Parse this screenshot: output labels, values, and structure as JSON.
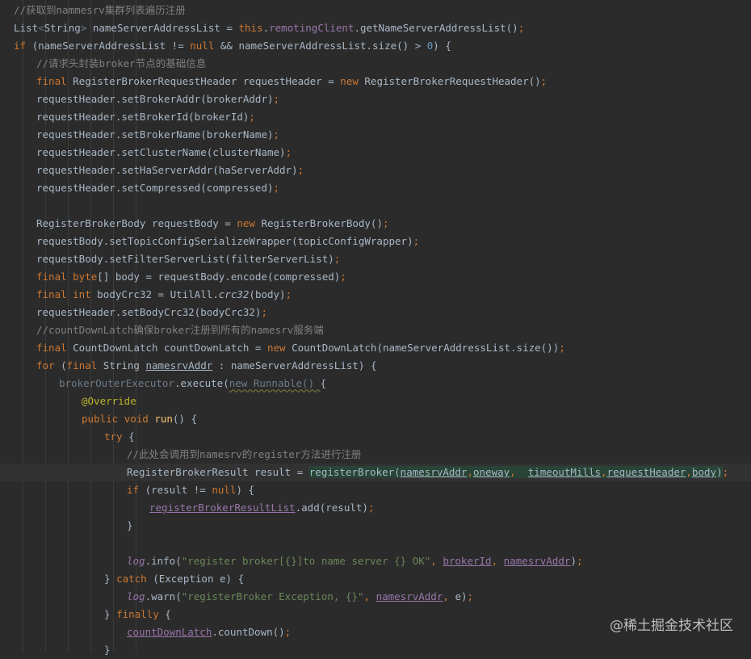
{
  "editor": {
    "lines": [
      {
        "indent": 0,
        "tokens": [
          {
            "t": "//获取到nammesrv集群列表遍历注册",
            "c": "cm"
          }
        ]
      },
      {
        "indent": 0,
        "tokens": [
          {
            "t": "List",
            "c": ""
          },
          {
            "t": "<",
            "c": "dim"
          },
          {
            "t": "String",
            "c": ""
          },
          {
            "t": "> ",
            "c": "dim"
          },
          {
            "t": "nameServerAddressList = ",
            "c": ""
          },
          {
            "t": "this",
            "c": "kw"
          },
          {
            "t": ".",
            "c": ""
          },
          {
            "t": "remotingClient",
            "c": "fld"
          },
          {
            "t": ".getNameServerAddressList()",
            "c": ""
          },
          {
            "t": ";",
            "c": "sc"
          }
        ]
      },
      {
        "indent": 0,
        "tokens": [
          {
            "t": "if ",
            "c": "kw"
          },
          {
            "t": "(nameServerAddressList != ",
            "c": ""
          },
          {
            "t": "null ",
            "c": "kw"
          },
          {
            "t": "&& nameServerAddressList.size() > ",
            "c": ""
          },
          {
            "t": "0",
            "c": "num"
          },
          {
            "t": ") {",
            "c": ""
          }
        ]
      },
      {
        "indent": 1,
        "tokens": [
          {
            "t": "//请求头封装broker节点的基础信息",
            "c": "cm"
          }
        ]
      },
      {
        "indent": 1,
        "tokens": [
          {
            "t": "final ",
            "c": "kw"
          },
          {
            "t": "RegisterBrokerRequestHeader requestHeader = ",
            "c": ""
          },
          {
            "t": "new ",
            "c": "kw"
          },
          {
            "t": "RegisterBrokerRequestHeader()",
            "c": ""
          },
          {
            "t": ";",
            "c": "sc"
          }
        ]
      },
      {
        "indent": 1,
        "tokens": [
          {
            "t": "requestHeader.setBrokerAddr(brokerAddr)",
            "c": ""
          },
          {
            "t": ";",
            "c": "sc"
          }
        ]
      },
      {
        "indent": 1,
        "tokens": [
          {
            "t": "requestHeader.setBrokerId(brokerId)",
            "c": ""
          },
          {
            "t": ";",
            "c": "sc"
          }
        ]
      },
      {
        "indent": 1,
        "tokens": [
          {
            "t": "requestHeader.setBrokerName(brokerName)",
            "c": ""
          },
          {
            "t": ";",
            "c": "sc"
          }
        ]
      },
      {
        "indent": 1,
        "tokens": [
          {
            "t": "requestHeader.setClusterName(clusterName)",
            "c": ""
          },
          {
            "t": ";",
            "c": "sc"
          }
        ]
      },
      {
        "indent": 1,
        "tokens": [
          {
            "t": "requestHeader.setHaServerAddr(haServerAddr)",
            "c": ""
          },
          {
            "t": ";",
            "c": "sc"
          }
        ]
      },
      {
        "indent": 1,
        "tokens": [
          {
            "t": "requestHeader.setCompressed(compressed)",
            "c": ""
          },
          {
            "t": ";",
            "c": "sc"
          }
        ]
      },
      {
        "indent": 1,
        "tokens": []
      },
      {
        "indent": 1,
        "tokens": [
          {
            "t": "RegisterBrokerBody requestBody = ",
            "c": ""
          },
          {
            "t": "new ",
            "c": "kw"
          },
          {
            "t": "RegisterBrokerBody()",
            "c": ""
          },
          {
            "t": ";",
            "c": "sc"
          }
        ]
      },
      {
        "indent": 1,
        "tokens": [
          {
            "t": "requestBody.setTopicConfigSerializeWrapper(topicConfigWrapper)",
            "c": ""
          },
          {
            "t": ";",
            "c": "sc"
          }
        ]
      },
      {
        "indent": 1,
        "tokens": [
          {
            "t": "requestBody.setFilterServerList(filterServerList)",
            "c": ""
          },
          {
            "t": ";",
            "c": "sc"
          }
        ]
      },
      {
        "indent": 1,
        "tokens": [
          {
            "t": "final ",
            "c": "kw"
          },
          {
            "t": "byte",
            "c": "kw"
          },
          {
            "t": "[] body = requestBody.encode(compressed)",
            "c": ""
          },
          {
            "t": ";",
            "c": "sc"
          }
        ]
      },
      {
        "indent": 1,
        "tokens": [
          {
            "t": "final ",
            "c": "kw"
          },
          {
            "t": "int ",
            "c": "kw"
          },
          {
            "t": "bodyCrc32 = UtilAll.",
            "c": ""
          },
          {
            "t": "crc32",
            "c": "it"
          },
          {
            "t": "(body)",
            "c": ""
          },
          {
            "t": ";",
            "c": "sc"
          }
        ]
      },
      {
        "indent": 1,
        "tokens": [
          {
            "t": "requestHeader.setBodyCrc32(bodyCrc32)",
            "c": ""
          },
          {
            "t": ";",
            "c": "sc"
          }
        ]
      },
      {
        "indent": 1,
        "tokens": [
          {
            "t": "//countDownLatch确保broker注册到所有的namesrv服务端",
            "c": "cm"
          }
        ]
      },
      {
        "indent": 1,
        "tokens": [
          {
            "t": "final ",
            "c": "kw"
          },
          {
            "t": "CountDownLatch countDownLatch = ",
            "c": ""
          },
          {
            "t": "new ",
            "c": "kw"
          },
          {
            "t": "CountDownLatch(nameServerAddressList.size())",
            "c": ""
          },
          {
            "t": ";",
            "c": "sc"
          }
        ]
      },
      {
        "indent": 1,
        "tokens": [
          {
            "t": "for ",
            "c": "kw"
          },
          {
            "t": "(",
            "c": ""
          },
          {
            "t": "final ",
            "c": "kw"
          },
          {
            "t": "String ",
            "c": ""
          },
          {
            "t": "namesrvAddr",
            "c": "ul"
          },
          {
            "t": " : nameServerAddressList) {",
            "c": ""
          }
        ]
      },
      {
        "indent": 2,
        "tokens": [
          {
            "t": "brokerOuterExecutor",
            "c": "dim"
          },
          {
            "t": ".execute(",
            "c": ""
          },
          {
            "t": "new Runnable() ",
            "c": "dim squig"
          },
          {
            "t": "{",
            "c": ""
          }
        ]
      },
      {
        "indent": 3,
        "tokens": [
          {
            "t": "@Override",
            "c": "ann"
          }
        ]
      },
      {
        "indent": 3,
        "tokens": [
          {
            "t": "public ",
            "c": "kw"
          },
          {
            "t": "void ",
            "c": "kw"
          },
          {
            "t": "run",
            "c": "fn"
          },
          {
            "t": "() {",
            "c": ""
          }
        ]
      },
      {
        "indent": 4,
        "tokens": [
          {
            "t": "try ",
            "c": "kw"
          },
          {
            "t": "{",
            "c": ""
          }
        ]
      },
      {
        "indent": 5,
        "tokens": [
          {
            "t": "//此处会调用到namesrv的register方法进行注册",
            "c": "cm"
          }
        ]
      },
      {
        "indent": 5,
        "hl": true,
        "tokens": [
          {
            "t": "RegisterBrokerResult result = ",
            "c": ""
          },
          {
            "t": "registerBroker(",
            "c": "gbox"
          },
          {
            "t": "namesrvAddr",
            "c": "gbox fld ul"
          },
          {
            "t": ",",
            "c": "gbox sc"
          },
          {
            "t": "oneway",
            "c": "gbox fld ul"
          },
          {
            "t": ",  ",
            "c": "gbox sc"
          },
          {
            "t": "timeoutMills",
            "c": "gbox fld ul"
          },
          {
            "t": ",",
            "c": "gbox sc"
          },
          {
            "t": "requestHeader",
            "c": "gbox fld ul"
          },
          {
            "t": ",",
            "c": "gbox sc"
          },
          {
            "t": "body",
            "c": "gbox fld ul"
          },
          {
            "t": ")",
            "c": "gbox"
          },
          {
            "t": ";",
            "c": "sc"
          }
        ]
      },
      {
        "indent": 5,
        "tokens": [
          {
            "t": "if ",
            "c": "kw"
          },
          {
            "t": "(result != ",
            "c": ""
          },
          {
            "t": "null",
            "c": "kw"
          },
          {
            "t": ") {",
            "c": ""
          }
        ]
      },
      {
        "indent": 6,
        "tokens": [
          {
            "t": "registerBrokerResultList",
            "c": "fld ul"
          },
          {
            "t": ".add(result)",
            "c": ""
          },
          {
            "t": ";",
            "c": "sc"
          }
        ]
      },
      {
        "indent": 5,
        "tokens": [
          {
            "t": "}",
            "c": ""
          }
        ]
      },
      {
        "indent": 5,
        "tokens": []
      },
      {
        "indent": 5,
        "tokens": [
          {
            "t": "log",
            "c": "fld it"
          },
          {
            "t": ".info(",
            "c": ""
          },
          {
            "t": "\"register broker[{}]to name server {} OK\"",
            "c": "str"
          },
          {
            "t": ", ",
            "c": "sc"
          },
          {
            "t": "brokerId",
            "c": "fld ul"
          },
          {
            "t": ", ",
            "c": "sc"
          },
          {
            "t": "namesrvAddr",
            "c": "fld ul"
          },
          {
            "t": ")",
            "c": ""
          },
          {
            "t": ";",
            "c": "sc"
          }
        ]
      },
      {
        "indent": 4,
        "tokens": [
          {
            "t": "} ",
            "c": ""
          },
          {
            "t": "catch ",
            "c": "kw"
          },
          {
            "t": "(Exception e) {",
            "c": ""
          }
        ]
      },
      {
        "indent": 5,
        "tokens": [
          {
            "t": "log",
            "c": "fld it"
          },
          {
            "t": ".warn(",
            "c": ""
          },
          {
            "t": "\"registerBroker Exception, {}\"",
            "c": "str"
          },
          {
            "t": ", ",
            "c": "sc"
          },
          {
            "t": "namesrvAddr",
            "c": "fld ul"
          },
          {
            "t": ", ",
            "c": "sc"
          },
          {
            "t": "e)",
            "c": ""
          },
          {
            "t": ";",
            "c": "sc"
          }
        ]
      },
      {
        "indent": 4,
        "tokens": [
          {
            "t": "} ",
            "c": ""
          },
          {
            "t": "finally ",
            "c": "kw"
          },
          {
            "t": "{",
            "c": ""
          }
        ]
      },
      {
        "indent": 5,
        "tokens": [
          {
            "t": "countDownLatch",
            "c": "fld ul"
          },
          {
            "t": ".countDown()",
            "c": ""
          },
          {
            "t": ";",
            "c": "sc"
          }
        ]
      },
      {
        "indent": 4,
        "tokens": [
          {
            "t": "}",
            "c": ""
          }
        ]
      }
    ]
  },
  "watermark": "@稀土掘金技术社区"
}
